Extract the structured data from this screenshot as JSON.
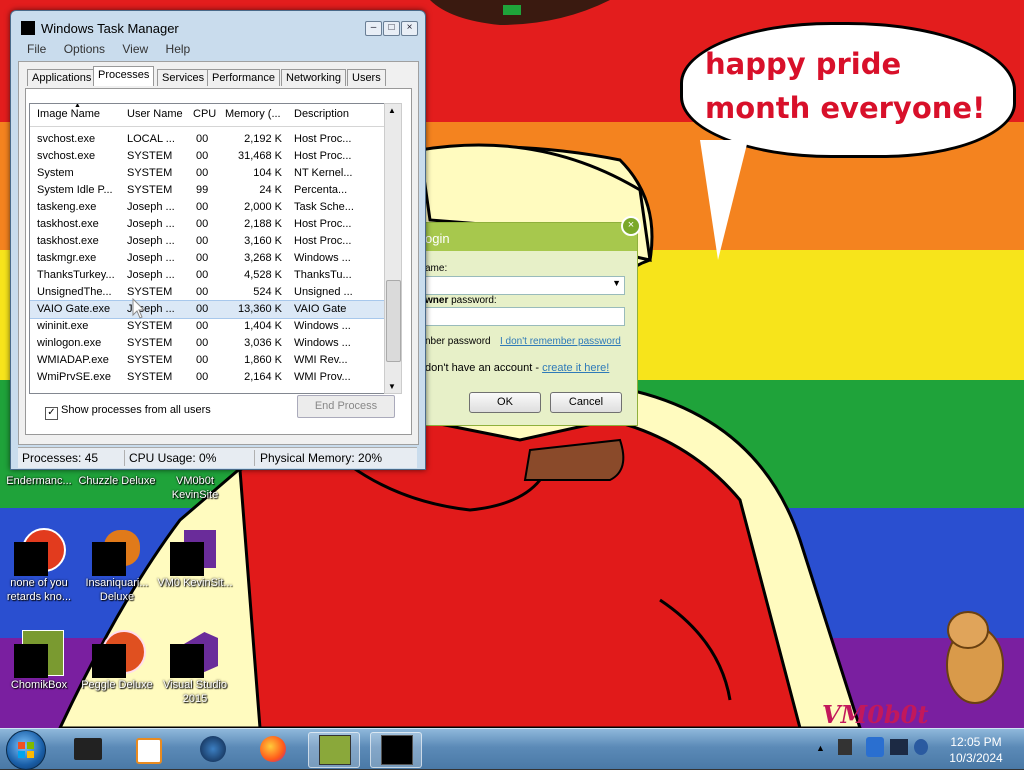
{
  "wallpaper": {
    "stripes": [
      "#e31d1d",
      "#f4831f",
      "#f7e41b",
      "#1fa33a",
      "#2a4fd0",
      "#7a1fa0"
    ],
    "speech_bubble": "happy pride month everyone!",
    "watermark": "VM0b0t"
  },
  "task_manager": {
    "title": "Windows Task Manager",
    "menu": [
      "File",
      "Options",
      "View",
      "Help"
    ],
    "tabs": [
      "Applications",
      "Processes",
      "Services",
      "Performance",
      "Networking",
      "Users"
    ],
    "active_tab": "Processes",
    "columns": [
      "Image Name",
      "User Name",
      "CPU",
      "Memory (...",
      "Description"
    ],
    "rows": [
      {
        "name": "svchost.exe",
        "user": "LOCAL ...",
        "cpu": "00",
        "mem": "2,192 K",
        "desc": "Host Proc..."
      },
      {
        "name": "svchost.exe",
        "user": "SYSTEM",
        "cpu": "00",
        "mem": "31,468 K",
        "desc": "Host Proc..."
      },
      {
        "name": "System",
        "user": "SYSTEM",
        "cpu": "00",
        "mem": "104 K",
        "desc": "NT Kernel..."
      },
      {
        "name": "System Idle P...",
        "user": "SYSTEM",
        "cpu": "99",
        "mem": "24 K",
        "desc": "Percenta..."
      },
      {
        "name": "taskeng.exe",
        "user": "Joseph ...",
        "cpu": "00",
        "mem": "2,000 K",
        "desc": "Task Sche..."
      },
      {
        "name": "taskhost.exe",
        "user": "Joseph ...",
        "cpu": "00",
        "mem": "2,188 K",
        "desc": "Host Proc..."
      },
      {
        "name": "taskhost.exe",
        "user": "Joseph ...",
        "cpu": "00",
        "mem": "3,160 K",
        "desc": "Host Proc..."
      },
      {
        "name": "taskmgr.exe",
        "user": "Joseph ...",
        "cpu": "00",
        "mem": "3,268 K",
        "desc": "Windows ..."
      },
      {
        "name": "ThanksTurkey...",
        "user": "Joseph ...",
        "cpu": "00",
        "mem": "4,528 K",
        "desc": "ThanksTu..."
      },
      {
        "name": "UnsignedThe...",
        "user": "SYSTEM",
        "cpu": "00",
        "mem": "524 K",
        "desc": "Unsigned ..."
      },
      {
        "name": "VAIO Gate.exe",
        "user": "Joseph ...",
        "cpu": "00",
        "mem": "13,360 K",
        "desc": "VAIO Gate",
        "selected": true
      },
      {
        "name": "wininit.exe",
        "user": "SYSTEM",
        "cpu": "00",
        "mem": "1,404 K",
        "desc": "Windows ..."
      },
      {
        "name": "winlogon.exe",
        "user": "SYSTEM",
        "cpu": "00",
        "mem": "3,036 K",
        "desc": "Windows ..."
      },
      {
        "name": "WMIADAP.exe",
        "user": "SYSTEM",
        "cpu": "00",
        "mem": "1,860 K",
        "desc": "WMI Rev..."
      },
      {
        "name": "WmiPrvSE.exe",
        "user": "SYSTEM",
        "cpu": "00",
        "mem": "2,164 K",
        "desc": "WMI Prov..."
      }
    ],
    "show_all_label": "Show processes from all users",
    "show_all_checked": "✓",
    "end_process_label": "End Process",
    "status": {
      "processes": "Processes: 45",
      "cpu": "CPU Usage: 0%",
      "memory": "Physical Memory: 20%"
    }
  },
  "login_dialog": {
    "title": "ogin",
    "close_glyph": "×",
    "username_label": "ame:",
    "password_label_bold": "wner",
    "password_label_rest": " password:",
    "remember_label": "nber password",
    "forgot_link": "I don't remember password",
    "no_account_text": "don't have an account - ",
    "create_link": "create it here!",
    "ok_label": "OK",
    "cancel_label": "Cancel"
  },
  "desktop_icons": [
    {
      "label": "Endermanc...",
      "color": "#4a4a4a"
    },
    {
      "label": "Chuzzle Deluxe",
      "color": "#c98a2b"
    },
    {
      "label": "VM0b0t KevinSite",
      "color": "#553377"
    },
    {
      "label": "none of you retards kno...",
      "color": "#e23b1e"
    },
    {
      "label": "Insaniquari... Deluxe",
      "color": "#e07a1a"
    },
    {
      "label": "VM0 KevinSit...",
      "color": "#6a2c9a"
    },
    {
      "label": "ChomikBox",
      "color": "#7a9a30"
    },
    {
      "label": "Peggle Deluxe",
      "color": "#e05020"
    },
    {
      "label": "Visual Studio 2015",
      "color": "#6a2c9a"
    }
  ],
  "taskbar": {
    "icons": [
      "chromebook-icon",
      "media-player-icon",
      "firefox-nightly-icon",
      "firefox-icon",
      "chomikbox-icon",
      "terminal-icon"
    ],
    "clock_time": "12:05 PM",
    "clock_date": "10/3/2024"
  }
}
